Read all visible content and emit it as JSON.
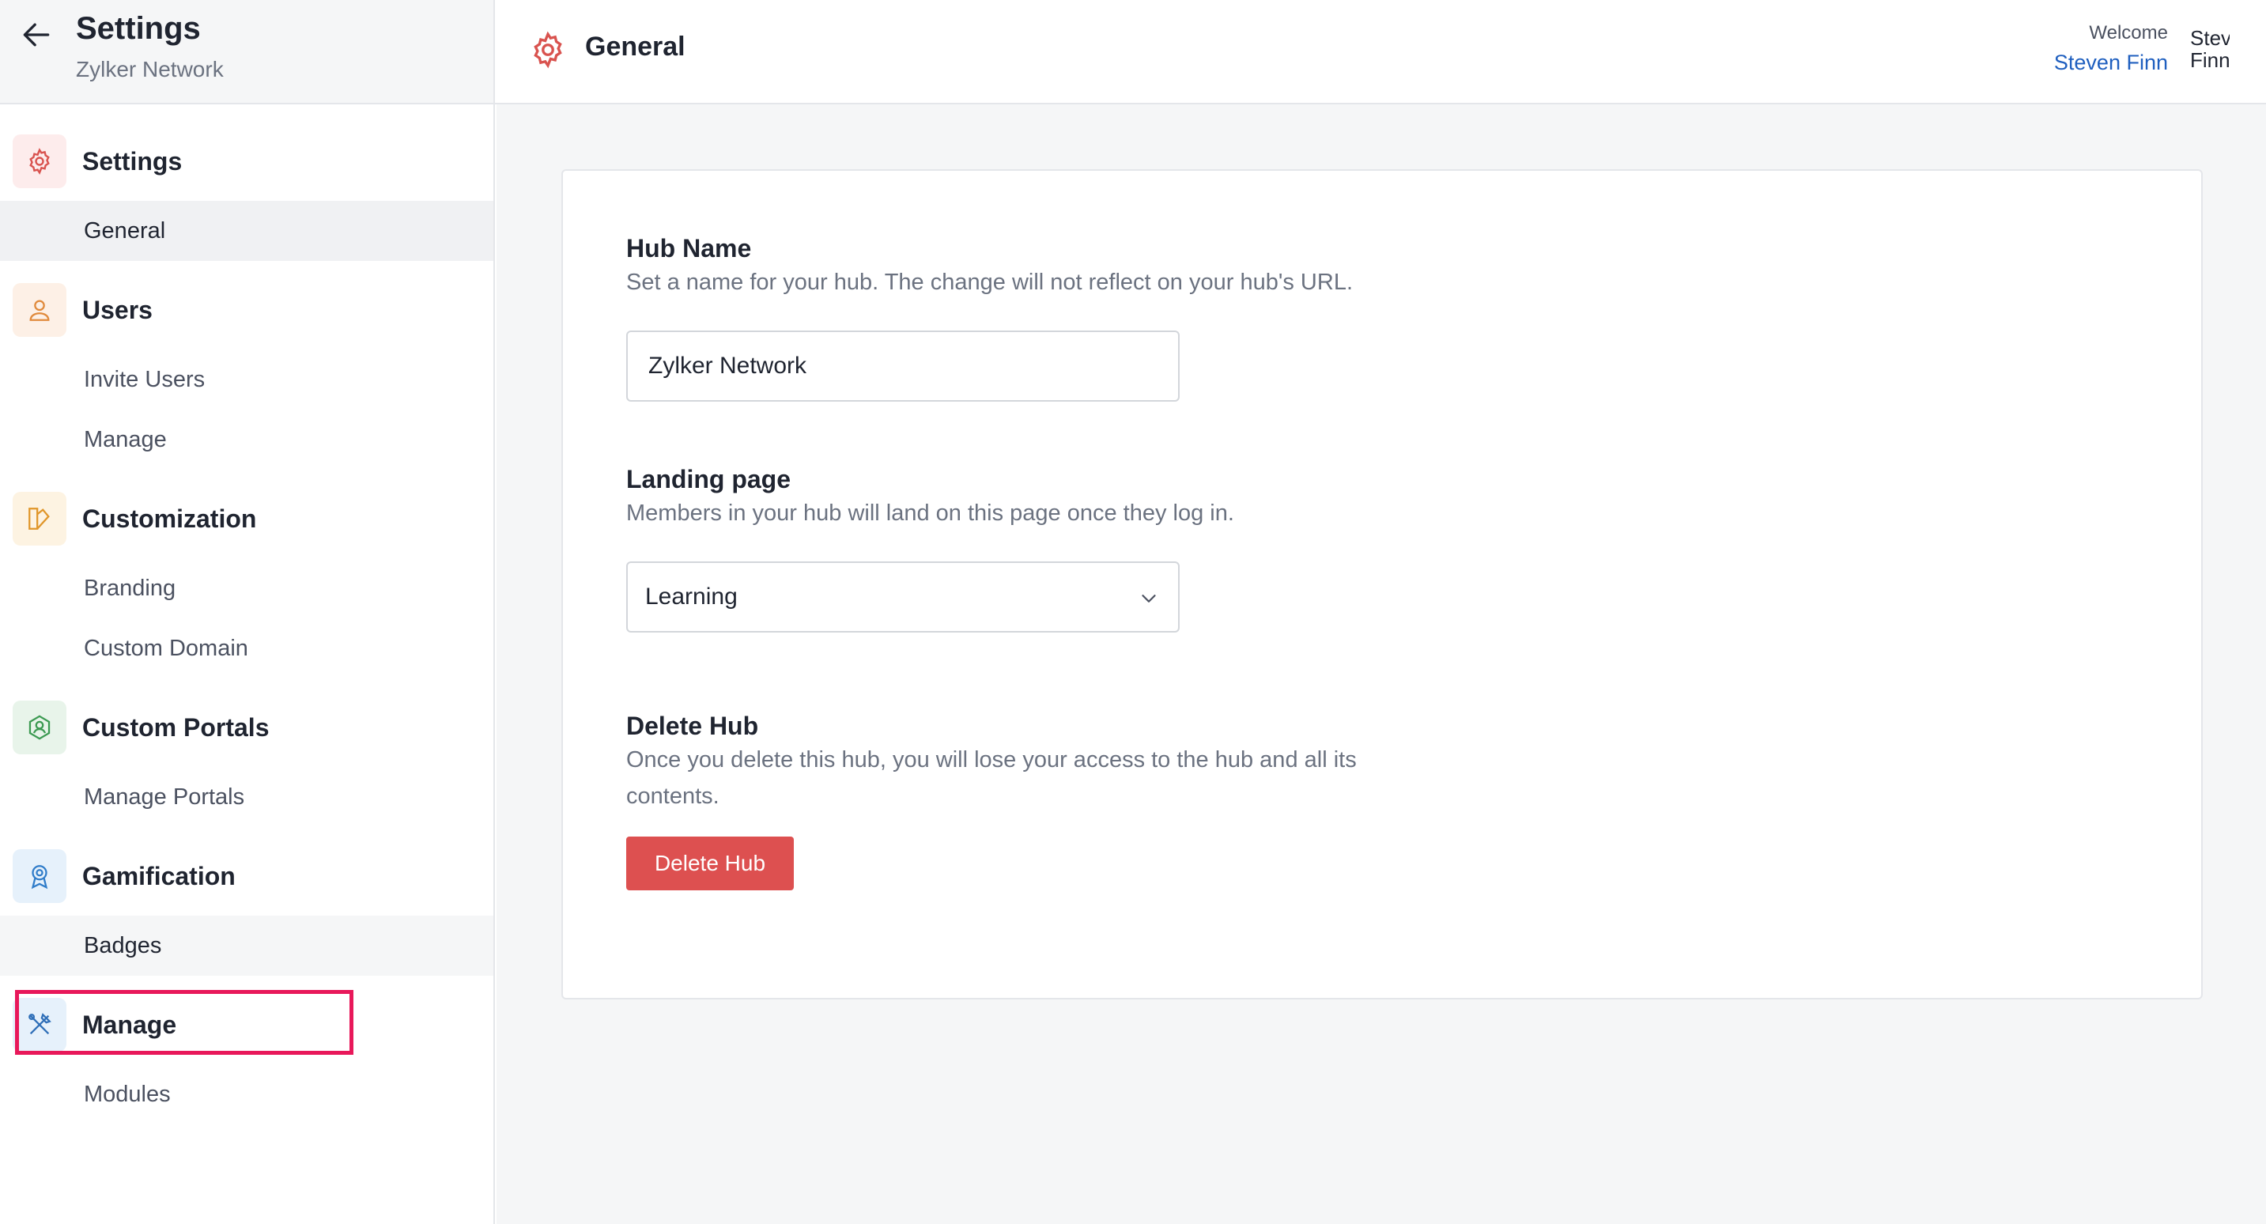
{
  "sidebar": {
    "title": "Settings",
    "subtitle": "Zylker Network",
    "sections": [
      {
        "label": "Settings",
        "icon": "gear-icon",
        "items": [
          "General"
        ]
      },
      {
        "label": "Users",
        "icon": "user-icon",
        "items": [
          "Invite Users",
          "Manage"
        ]
      },
      {
        "label": "Customization",
        "icon": "palette-icon",
        "items": [
          "Branding",
          "Custom Domain"
        ]
      },
      {
        "label": "Custom Portals",
        "icon": "portal-icon",
        "items": [
          "Manage Portals"
        ]
      },
      {
        "label": "Gamification",
        "icon": "award-icon",
        "items": [
          "Badges"
        ]
      },
      {
        "label": "Manage",
        "icon": "tools-icon",
        "items": [
          "Modules"
        ]
      }
    ],
    "active_item": "General"
  },
  "topbar": {
    "title": "General",
    "welcome_label": "Welcome",
    "user_name": "Steven Finn",
    "user_short_1": "Stev",
    "user_short_2": "Finn"
  },
  "form": {
    "hub_name": {
      "title": "Hub Name",
      "description": "Set a name for your hub. The change will not reflect on your hub's URL.",
      "value": "Zylker Network"
    },
    "landing_page": {
      "title": "Landing page",
      "description": "Members in your hub will land on this page once they log in.",
      "selected": "Learning"
    },
    "delete_hub": {
      "title": "Delete Hub",
      "description_line1": "Once you delete this hub, you will lose your access to the hub and all its",
      "description_line2": "contents.",
      "button_label": "Delete Hub"
    }
  },
  "colors": {
    "accent_red": "#dd5050",
    "highlight": "#e8185a",
    "link_blue": "#1f5fbf"
  }
}
